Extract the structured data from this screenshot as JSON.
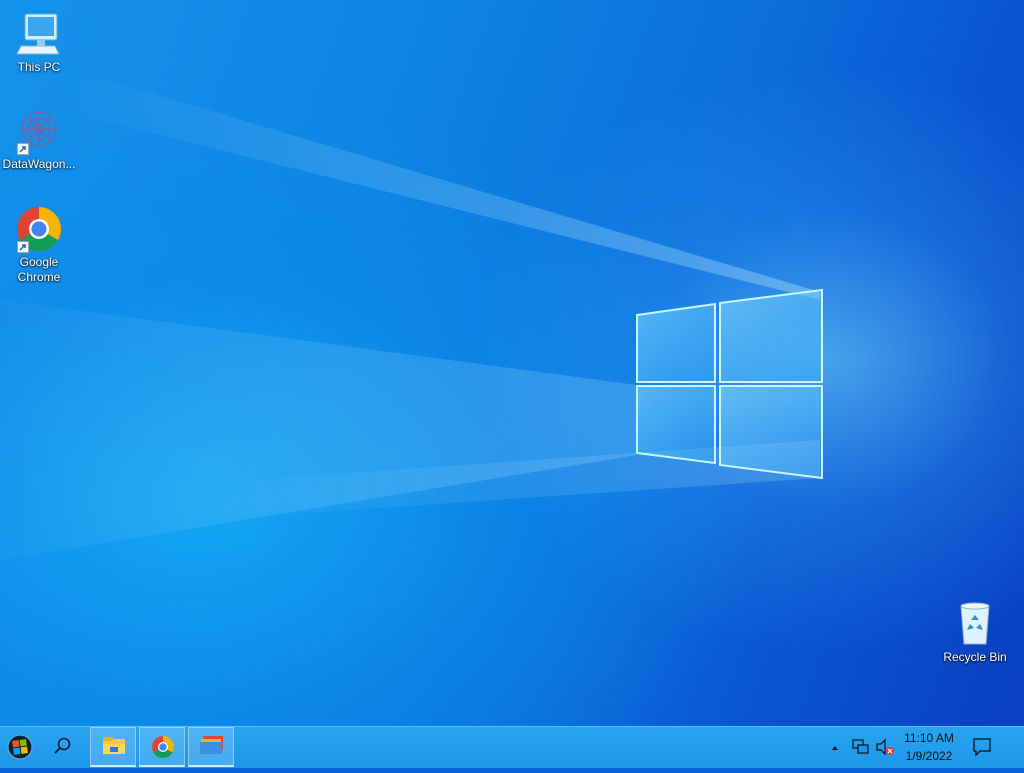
{
  "desktop": {
    "icons": [
      {
        "label": "This PC",
        "icon": "computer-icon"
      },
      {
        "label": "DataWagon...",
        "icon": "datawagon-app-icon",
        "shortcut": true
      },
      {
        "label": "Google Chrome",
        "icon": "chrome-icon",
        "shortcut": true
      },
      {
        "label": "Recycle Bin",
        "icon": "recycle-bin-icon"
      }
    ],
    "wallpaper": {
      "accent": "#0a63d8",
      "light": "#7fe0ff"
    }
  },
  "taskbar": {
    "color": "#1e97ea",
    "start": {
      "icon": "windows-start-icon"
    },
    "search": {
      "icon": "search-icon"
    },
    "pinned": [
      {
        "name": "File Explorer",
        "icon": "file-explorer-icon"
      },
      {
        "name": "Google Chrome",
        "icon": "chrome-icon"
      },
      {
        "name": "Files",
        "icon": "folder-stack-icon"
      }
    ],
    "tray": {
      "chevron_icon": "chevron-up-icon",
      "network_icon": "network-icon",
      "volume_icon": "volume-muted-icon",
      "time": "11:10 AM",
      "date": "1/9/2022",
      "notifications_icon": "notifications-icon"
    }
  }
}
